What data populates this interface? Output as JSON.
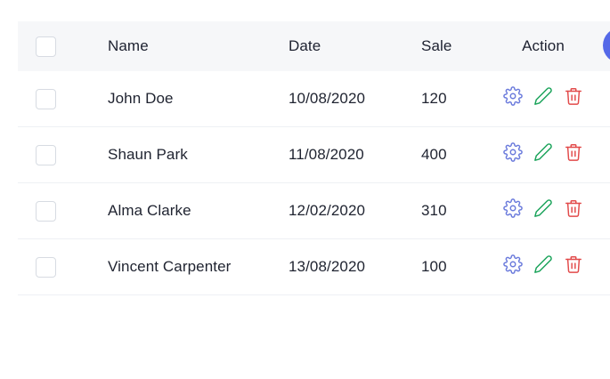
{
  "table": {
    "headers": {
      "name": "Name",
      "date": "Date",
      "sale": "Sale",
      "action": "Action"
    },
    "rows": [
      {
        "name": "John Doe",
        "date": "10/08/2020",
        "sale": "120"
      },
      {
        "name": "Shaun Park",
        "date": "11/08/2020",
        "sale": "400"
      },
      {
        "name": "Alma Clarke",
        "date": "12/02/2020",
        "sale": "310"
      },
      {
        "name": "Vincent Carpenter",
        "date": "13/08/2020",
        "sale": "100"
      }
    ]
  },
  "icons": {
    "settings": "settings-gear-icon",
    "edit": "pencil-edit-icon",
    "delete": "trash-delete-icon"
  },
  "colors": {
    "header_bg": "#f6f7f9",
    "settings_icon": "#6b7bdc",
    "edit_icon": "#1aa35a",
    "delete_icon": "#e24a4a",
    "accent": "#5569e8",
    "row_divider": "#eef0f4"
  }
}
